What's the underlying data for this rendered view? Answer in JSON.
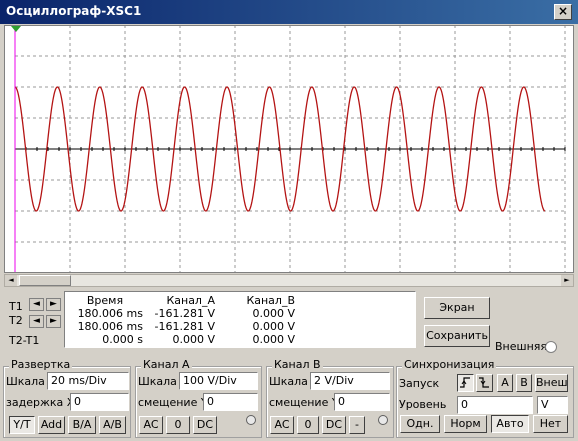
{
  "window": {
    "title": "Осциллограф-XSC1",
    "close": "×"
  },
  "signal": {
    "cycles": 12.5,
    "amplitude_div": 2,
    "trace_color": "#b41414",
    "grid_color": "#9a9a9a",
    "cursor_color": "#ee00ee"
  },
  "scroll": {
    "left": "◄",
    "right": "►"
  },
  "cursors": {
    "t1": "T1",
    "t2": "T2",
    "dt": "T2-T1",
    "left": "◄",
    "right": "►"
  },
  "measurements": {
    "headers": [
      "Время",
      "Канал_A",
      "Канал_B"
    ],
    "rows": [
      [
        "180.006 ms",
        "-161.281 V",
        "0.000 V"
      ],
      [
        "180.006 ms",
        "-161.281 V",
        "0.000 V"
      ],
      [
        "0.000 s",
        "0.000 V",
        "0.000 V"
      ]
    ]
  },
  "side": {
    "screen": "Экран",
    "save": "Сохранить",
    "external": "Внешняя"
  },
  "timebase": {
    "title": "Развертка",
    "scale_label": "Шкала",
    "scale_value": "20 ms/Div",
    "delay_label": "задержка X",
    "delay_value": "0",
    "modes": [
      "Y/T",
      "Add",
      "B/A",
      "A/B"
    ]
  },
  "channel_a": {
    "title": "Канал A",
    "scale_label": "Шкала",
    "scale_value": "100  V/Div",
    "offset_label": "смещение Y",
    "offset_value": "0",
    "coupling": [
      "AC",
      "0",
      "DC"
    ]
  },
  "channel_b": {
    "title": "Канал B",
    "scale_label": "Шкала",
    "scale_value": "2  V/Div",
    "offset_label": "смещение Y",
    "offset_value": "0",
    "coupling": [
      "AC",
      "0",
      "DC",
      "-"
    ]
  },
  "trigger": {
    "title": "Синхронизация",
    "edge_label": "Запуск",
    "sources": [
      "A",
      "B",
      "Внеш"
    ],
    "level_label": "Уровень",
    "level_value": "0",
    "level_unit": "V",
    "modes": [
      "Одн.",
      "Норм",
      "Авто",
      "Нет"
    ]
  }
}
